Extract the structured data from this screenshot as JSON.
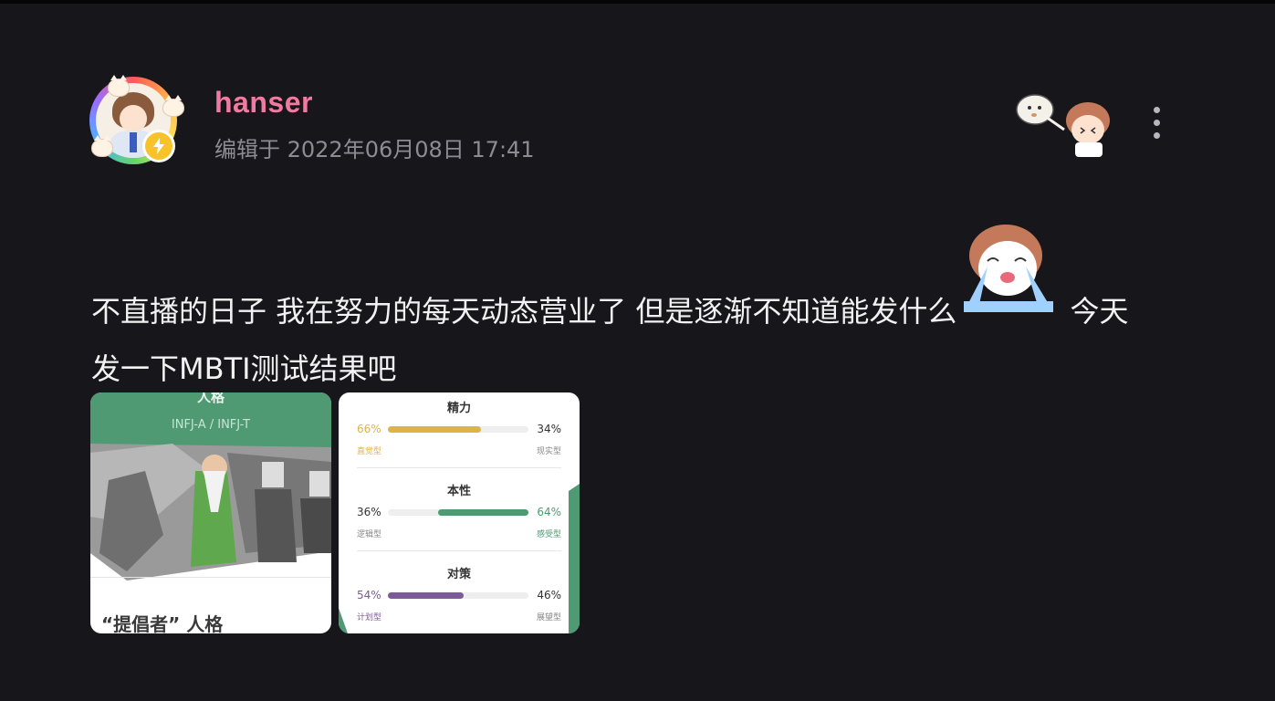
{
  "post": {
    "username": "hanser",
    "edit_time": "编辑于 2022年06月08日 17:41",
    "text_line1_a": "不直播的日子 我在努力的每天动态营业了 但是逐渐不知道能发什么",
    "text_line1_b": " 今天",
    "text_line2": "发一下MBTI测试结果吧"
  },
  "image1": {
    "title": "人格",
    "type_code": "INFJ-A / INFJ-T",
    "name": "“提倡者” 人格"
  },
  "image2": {
    "traits": [
      {
        "title": "精力",
        "left_pct": "66%",
        "right_pct": "34%",
        "left_label": "直觉型",
        "right_label": "现实型",
        "fill_side": "left",
        "fill": 0.66,
        "color": "#e0b24a"
      },
      {
        "title": "本性",
        "left_pct": "36%",
        "right_pct": "64%",
        "left_label": "逻辑型",
        "right_label": "感受型",
        "fill_side": "right",
        "fill": 0.64,
        "color": "#4f9a73"
      },
      {
        "title": "对策",
        "left_pct": "54%",
        "right_pct": "46%",
        "left_label": "计划型",
        "right_label": "展望型",
        "fill_side": "left",
        "fill": 0.54,
        "color": "#7d5b97"
      }
    ]
  },
  "colors": {
    "background": "#17161b",
    "username": "#f07aa0",
    "meta_text": "#8d8c92",
    "body_text": "#f2f2f2",
    "card_green": "#4f9a73"
  },
  "icons": {
    "more": "more-vertical-icon",
    "badge": "lightning-icon"
  }
}
